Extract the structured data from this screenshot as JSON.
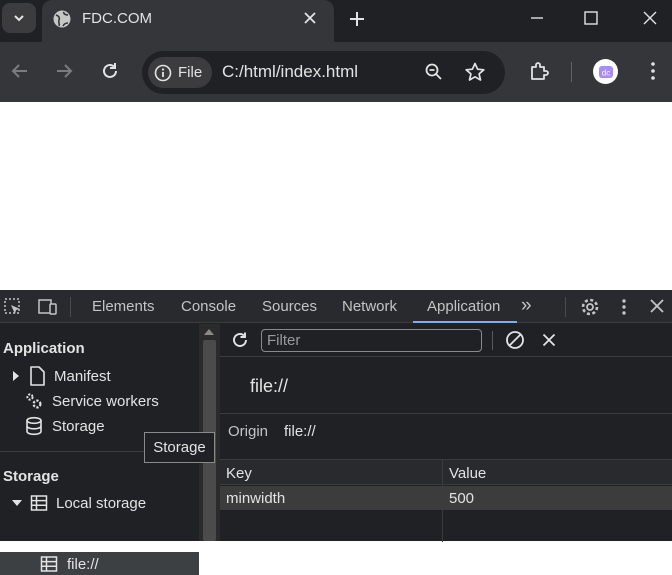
{
  "browser": {
    "tab_title": "FDC.COM",
    "new_tab_symbol": "+",
    "url": "C:/html/index.html",
    "security_chip_label": "File",
    "avatar_text": "dc"
  },
  "devtools": {
    "tabs": [
      "Elements",
      "Console",
      "Sources",
      "Network",
      "Application"
    ],
    "more_tabs_symbol": "»",
    "active_tab": "Application",
    "sidebar": {
      "application_heading": "Application",
      "application_items": [
        "Manifest",
        "Service workers",
        "Storage"
      ],
      "storage_heading": "Storage",
      "local_storage_label": "Local storage",
      "local_storage_child": "file://"
    },
    "tooltip": "Storage",
    "filter_placeholder": "Filter",
    "origin_title": "file://",
    "origin_label": "Origin",
    "origin_value": "file://",
    "table": {
      "headers": [
        "Key",
        "Value"
      ],
      "rows": [
        {
          "key": "minwidth",
          "value": "500"
        }
      ]
    }
  },
  "colors": {
    "chrome_dark": "#202124",
    "toolbar": "#35363a",
    "accent": "#7cacf8"
  }
}
